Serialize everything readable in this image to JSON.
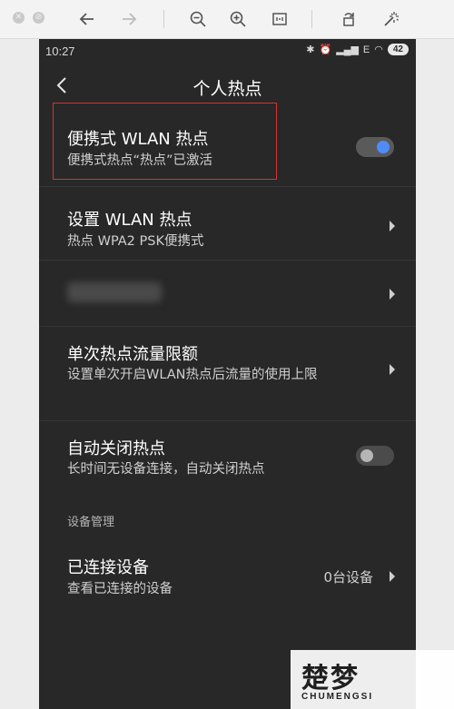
{
  "viewer": {
    "tools": [
      "back-icon",
      "forward-icon",
      "zoom-out-icon",
      "zoom-in-icon",
      "fit-icon",
      "rotate-icon",
      "magic-wand-icon"
    ]
  },
  "status_bar": {
    "time": "10:27",
    "signal_text": "E",
    "battery": "42"
  },
  "header": {
    "title": "个人热点"
  },
  "rows": [
    {
      "title": "便携式 WLAN 热点",
      "subtitle": "便携式热点“热点”已激活",
      "control": "toggle",
      "toggle_on": true
    },
    {
      "title": "设置 WLAN 热点",
      "subtitle": "热点 WPA2 PSK便携式",
      "control": "chevron"
    },
    {
      "title": "",
      "subtitle": "",
      "control": "chevron"
    },
    {
      "title": "单次热点流量限额",
      "subtitle": "设置单次开启WLAN热点后流量的使用上限",
      "control": "chevron"
    },
    {
      "title": "自动关闭热点",
      "subtitle": "长时间无设备连接，自动关闭热点",
      "control": "toggle",
      "toggle_on": false
    }
  ],
  "section": {
    "header": "设备管理"
  },
  "connected": {
    "title": "已连接设备",
    "subtitle": "查看已连接的设备",
    "value": "0台设备"
  },
  "watermark": {
    "logo": "楚梦",
    "sub": "CHUMENGSI"
  },
  "colors": {
    "background": "#282828",
    "toggle_accent": "#4f8cf7",
    "highlight": "#d6332f"
  }
}
